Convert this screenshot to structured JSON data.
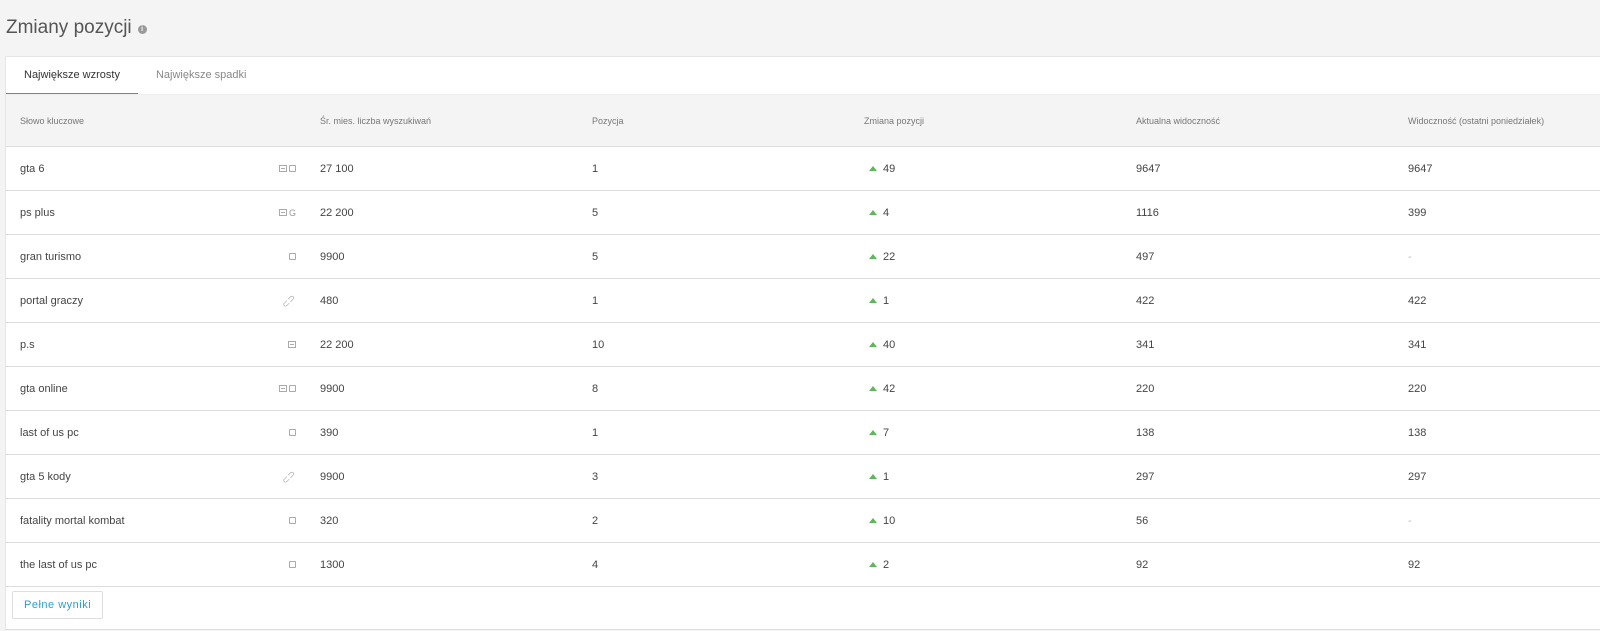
{
  "title": "Zmiany pozycji",
  "tabs": [
    "Największe wzrosty",
    "Największe spadki"
  ],
  "columns": [
    "Słowo kluczowe",
    "Śr. mies. liczba wyszukiwań",
    "Pozycja",
    "Zmiana pozycji",
    "Aktualna widoczność",
    "Widoczność (ostatni poniedziałek)"
  ],
  "rows": [
    {
      "keyword": "gta 6",
      "icons": [
        "serp-icon",
        "image-icon"
      ],
      "searches": "27 100",
      "position": "1",
      "change": "49",
      "visibility": "9647",
      "last_monday": "9647"
    },
    {
      "keyword": "ps plus",
      "icons": [
        "serp-icon",
        "google-icon"
      ],
      "searches": "22 200",
      "position": "5",
      "change": "4",
      "visibility": "1116",
      "last_monday": "399"
    },
    {
      "keyword": "gran turismo",
      "icons": [
        "image-icon"
      ],
      "searches": "9900",
      "position": "5",
      "change": "22",
      "visibility": "497",
      "last_monday": "-"
    },
    {
      "keyword": "portal graczy",
      "icons": [
        "link-icon"
      ],
      "searches": "480",
      "position": "1",
      "change": "1",
      "visibility": "422",
      "last_monday": "422"
    },
    {
      "keyword": "p.s",
      "icons": [
        "serp-icon"
      ],
      "searches": "22 200",
      "position": "10",
      "change": "40",
      "visibility": "341",
      "last_monday": "341"
    },
    {
      "keyword": "gta online",
      "icons": [
        "serp-icon",
        "image-icon"
      ],
      "searches": "9900",
      "position": "8",
      "change": "42",
      "visibility": "220",
      "last_monday": "220"
    },
    {
      "keyword": "last of us pc",
      "icons": [
        "image-icon"
      ],
      "searches": "390",
      "position": "1",
      "change": "7",
      "visibility": "138",
      "last_monday": "138"
    },
    {
      "keyword": "gta 5 kody",
      "icons": [
        "link-icon"
      ],
      "searches": "9900",
      "position": "3",
      "change": "1",
      "visibility": "297",
      "last_monday": "297"
    },
    {
      "keyword": "fatality mortal kombat",
      "icons": [
        "image-icon"
      ],
      "searches": "320",
      "position": "2",
      "change": "10",
      "visibility": "56",
      "last_monday": "-"
    },
    {
      "keyword": "the last of us pc",
      "icons": [
        "image-icon"
      ],
      "searches": "1300",
      "position": "4",
      "change": "2",
      "visibility": "92",
      "last_monday": "92"
    }
  ],
  "footer": {
    "button_label": "Pełne wyniki"
  },
  "colors": {
    "accent": "#2a9fd6",
    "up": "#5cb85c"
  }
}
